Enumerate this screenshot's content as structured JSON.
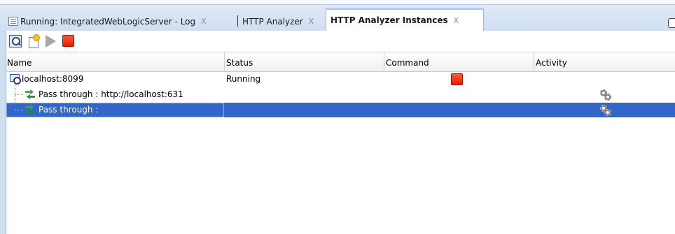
{
  "tabs": [
    {
      "label": "Running: IntegratedWebLogicServer - Log",
      "close": "X",
      "icon": "log-document-icon"
    },
    {
      "label": "HTTP Analyzer",
      "close": "X"
    },
    {
      "label": "HTTP Analyzer Instances",
      "close": "X",
      "active": true
    }
  ],
  "toolbar": {
    "icons": [
      "search-icon",
      "new-instance-icon",
      "start-icon",
      "stop-icon"
    ]
  },
  "table": {
    "columns": [
      "Name",
      "Status",
      "Command",
      "Activity"
    ],
    "rows": [
      {
        "name": "localhost:8099",
        "status": "Running",
        "command_icon": "stop-icon",
        "icon": "server-icon"
      },
      {
        "name": "Pass through : http://localhost:631",
        "activity_icon": "gear-icon",
        "icon": "pass-through-icon"
      },
      {
        "name": "Pass through :",
        "activity_icon": "gear-icon",
        "icon": "pass-through-icon",
        "selected": true
      }
    ]
  },
  "colors": {
    "selection": "#3167c8",
    "stop_button": "#e02000",
    "tab_strip": "#cfdff2"
  }
}
